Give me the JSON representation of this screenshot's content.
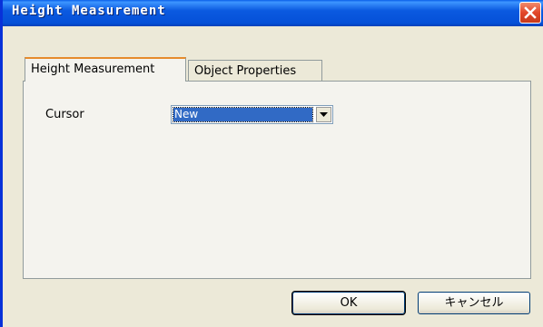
{
  "window": {
    "title": "Height Measurement"
  },
  "tabs": [
    {
      "label": "Height Measurement",
      "active": true
    },
    {
      "label": "Object Properties",
      "active": false
    }
  ],
  "form": {
    "cursor_label": "Cursor",
    "cursor_value": "New"
  },
  "buttons": {
    "ok": "OK",
    "cancel": "キャンセル"
  },
  "icons": {
    "close": "close-icon",
    "dropdown": "chevron-down-icon"
  },
  "colors": {
    "titlebar": "#0550d8",
    "close": "#e2472a",
    "selection": "#316ac5",
    "dialog_bg": "#ece9d8"
  }
}
